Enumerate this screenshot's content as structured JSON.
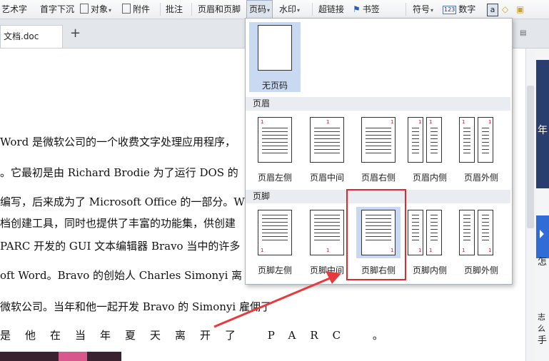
{
  "toolbar": {
    "items": [
      {
        "label": "艺术字"
      },
      {
        "label": "首字下沉"
      },
      {
        "label": "对象"
      },
      {
        "label": "附件"
      },
      {
        "label": "批注"
      },
      {
        "label": "页眉和页脚"
      },
      {
        "label": "页码"
      },
      {
        "label": "水印"
      },
      {
        "label": "超链接"
      },
      {
        "label": "书签"
      },
      {
        "label": "符号"
      },
      {
        "label": "数字"
      }
    ]
  },
  "tabs": {
    "doc_tab": "文档.doc"
  },
  "document": {
    "lines": [
      "Word 是微软公司的一个收费文字处理应用程序，",
      "。它最初是由 Richard Brodie 为了运行 DOS 的",
      "编写，后来成为了 Microsoft Office 的一部分。W",
      "档创建工具，同时也提供了丰富的功能集，供创建",
      "PARC 开发的 GUI 文本编辑器 Bravo 当中的许多",
      "oft Word。Bravo 的创始人 Charles Simonyi 离",
      "微软公司。当年和他一起开发 Bravo 的 Simonyi 雇佣了",
      "是他在当年夏天离开了 PARC 。"
    ]
  },
  "dropdown": {
    "no_page_label": "无页码",
    "header_section": "页眉",
    "footer_section": "页脚",
    "header_options": [
      "页眉左侧",
      "页眉中间",
      "页眉右侧",
      "页眉内侧",
      "页眉外侧"
    ],
    "footer_options": [
      "页脚左侧",
      "页脚中间",
      "页脚右侧",
      "页脚内侧",
      "页脚外侧"
    ],
    "page_number": "1"
  },
  "right_panel": {
    "glyph1": "年",
    "text1": "怎",
    "text2": "志么",
    "text3": "手"
  },
  "colors": {
    "highlight_border": "#e02929",
    "selected_bg": "#c9d9f1",
    "arrow": "#e8393c"
  }
}
